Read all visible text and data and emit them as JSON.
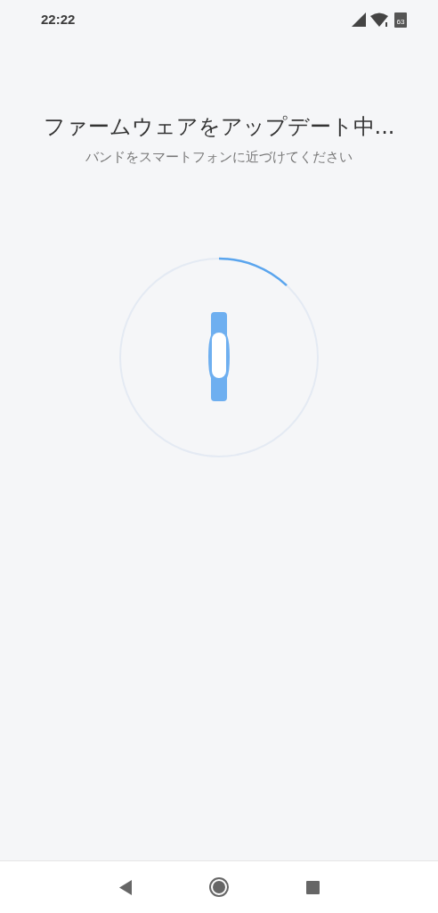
{
  "status_bar": {
    "time": "22:22",
    "battery": "63"
  },
  "title": "ファームウェアをアップデート中...",
  "subtitle": "バンドをスマートフォンに近づけてください"
}
